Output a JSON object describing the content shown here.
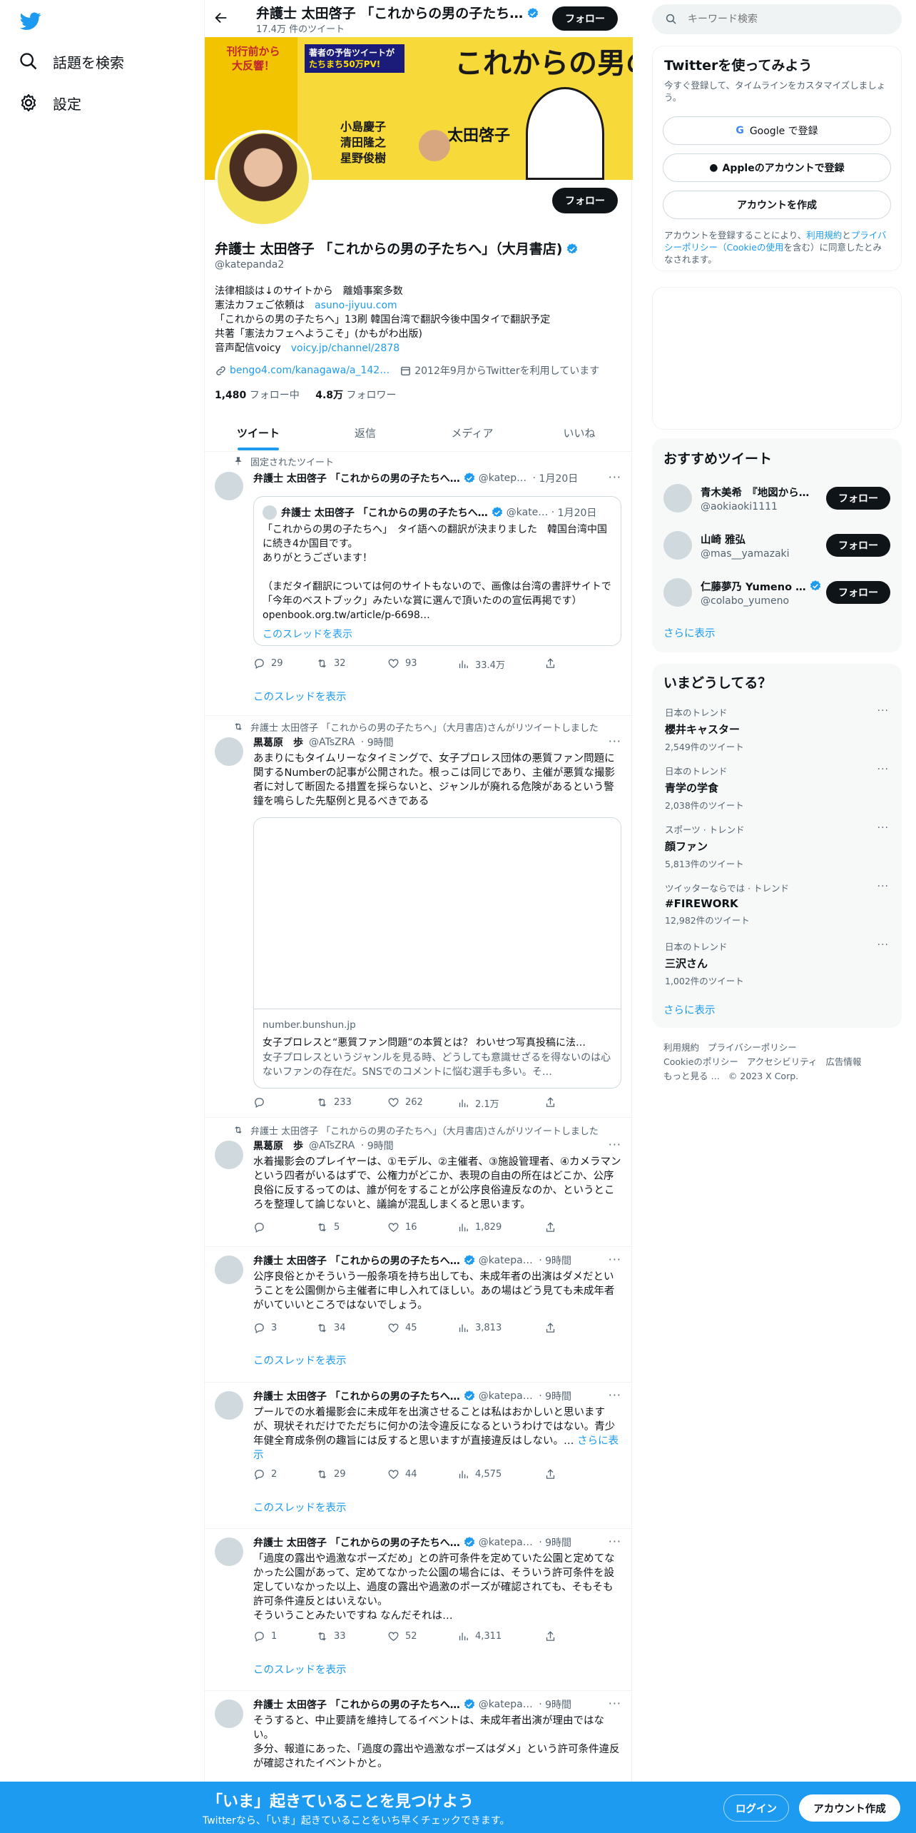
{
  "colors": {
    "accent": "#1d9bf0",
    "text": "#0f1419",
    "muted": "#536471",
    "banner_bg": "#f7d93a"
  },
  "left_nav": {
    "logo": "twitter-bird-icon",
    "items": [
      {
        "label": "話題を検索",
        "icon": "hashtag-search-icon"
      },
      {
        "label": "設定",
        "icon": "gear-icon"
      }
    ]
  },
  "header": {
    "name": "弁護士 太田啓子 「これからの男の子たち…",
    "tweet_count": "17.4万 件のツイート",
    "follow_label": "フォロー"
  },
  "banner": {
    "lines": [
      "これからの",
      "男の子たちへ"
    ],
    "badge": [
      "刊行前から",
      "大反響！"
    ],
    "promo": [
      "著者の予告ツイートが",
      "たちまち50万PV!"
    ],
    "author": "太田啓子",
    "guests": [
      "小島慶子",
      "清田隆之",
      "星野俊樹"
    ]
  },
  "profile": {
    "display_name": "弁護士 太田啓子 「これからの男の子たちへ」（大月書店)",
    "handle": "@katepanda2",
    "follow_label": "フォロー",
    "bio": [
      {
        "text": "法律相談は↓のサイトから　離婚事案多数",
        "link": ""
      },
      {
        "text": "憲法カフェご依頼は　",
        "link": "asuno-jiyuu.com"
      },
      {
        "text": "「これからの男の子たちへ」13刷 韓国台湾で翻訳今後中国タイで翻訳予定",
        "link": ""
      },
      {
        "text": "共著「憲法カフェへようこそ」(かもがわ出版)",
        "link": ""
      },
      {
        "text": "音声配信voicy　",
        "link": "voicy.jp/channel/2878"
      }
    ],
    "website": "bengo4.com/kanagawa/a_142…",
    "joined": "2012年9月からTwitterを利用しています",
    "following_count": "1,480",
    "following_label": "フォロー中",
    "followers_count": "4.8万",
    "followers_label": "フォロワー"
  },
  "tabs": [
    {
      "label": "ツイート",
      "active": true
    },
    {
      "label": "返信",
      "active": false
    },
    {
      "label": "メディア",
      "active": false
    },
    {
      "label": "いいね",
      "active": false
    }
  ],
  "tweets": [
    {
      "pinned_label": "固定されたツイート",
      "name": "弁護士 太田啓子 「これからの男の子たちへ…",
      "handle": "@katep…",
      "time": "1月20日",
      "quote": {
        "name": "弁護士 太田啓子 「これからの男の子たちへ…",
        "handle": "@kate…",
        "time": "1月20日",
        "text": "「これからの男の子たちへ」　タイ語への翻訳が決まりました　韓国台湾中国に続き4か国目です。\nありがとうございます！\n\n（まだタイ翻訳については何のサイトもないので、画像は台湾の書評サイトで「今年のベストブック」みたいな賞に選んで頂いたのの宣伝再掲です） openbook.org.tw/article/p-6698…",
        "thread_link": "このスレッドを表示"
      },
      "stats": {
        "replies": "29",
        "retweets": "32",
        "likes": "93",
        "views": "33.4万"
      },
      "thread_link": "このスレッドを表示"
    },
    {
      "retweet_label": "弁護士 太田啓子 「これからの男の子たちへ」（大月書店)さんがリツイートしました",
      "name": "黒葛原　歩",
      "handle": "@ATsZRA",
      "time": "9時間",
      "text": "あまりにもタイムリーなタイミングで、女子プロレス団体の悪質ファン問題に関するNumberの記事が公開された。根っこは同じであり、主催が悪質な撮影者に対して断固たる措置を採らないと、ジャンルが廃れる危険があるという警鐘を鳴らした先駆例と見るべきである",
      "card": {
        "domain": "number.bunshun.jp",
        "title": "女子プロレスと“悪質ファン問題”の本質とは？ わいせつ写真投稿に法…",
        "desc": "女子プロレスというジャンルを見る時、どうしても意識せざるを得ないのは心ないファンの存在だ。SNSでのコメントに悩む選手も多い。そ…"
      },
      "stats": {
        "replies": "",
        "retweets": "233",
        "likes": "262",
        "views": "2.1万"
      }
    },
    {
      "retweet_label": "弁護士 太田啓子 「これからの男の子たちへ」（大月書店)さんがリツイートしました",
      "name": "黒葛原　歩",
      "handle": "@ATsZRA",
      "time": "9時間",
      "text": "水着撮影会のプレイヤーは、①モデル、②主催者、③施設管理者、④カメラマンという四者がいるはずで、公権力がどこか、表現の自由の所在はどこか、公序良俗に反するってのは、誰が何をすることが公序良俗違反なのか、というところを整理して論じないと、議論が混乱しまくると思います。",
      "stats": {
        "replies": "",
        "retweets": "5",
        "likes": "16",
        "views": "1,829"
      }
    },
    {
      "name": "弁護士 太田啓子 「これからの男の子たちへ…",
      "handle": "@katepa…",
      "time": "9時間",
      "text": "公序良俗とかそういう一般条項を持ち出しても、未成年者の出演はダメだということを公園側から主催者に申し入れてほしい。あの場はどう見ても未成年者がいていいところではないでしょう。",
      "stats": {
        "replies": "3",
        "retweets": "34",
        "likes": "45",
        "views": "3,813"
      },
      "thread_link": "このスレッドを表示"
    },
    {
      "name": "弁護士 太田啓子 「これからの男の子たちへ…",
      "handle": "@katepa…",
      "time": "9時間",
      "text": "プールでの水着撮影会に未成年を出演させることは私はおかしいと思いますが、現状それだけでただちに何かの法令違反になるというわけではない。青少年健全育成条例の趣旨には反すると思いますが直接違反はしない。…",
      "more_link": "さらに表示",
      "stats": {
        "replies": "2",
        "retweets": "29",
        "likes": "44",
        "views": "4,575"
      },
      "thread_link": "このスレッドを表示"
    },
    {
      "name": "弁護士 太田啓子 「これからの男の子たちへ…",
      "handle": "@katepa…",
      "time": "9時間",
      "text": "「過度の露出や過激なポーズだめ」との許可条件を定めていた公園と定めてなかった公園があって、定めてなかった公園の場合には、そういう許可条件を設定していなかった以上、過度の露出や過激のポーズが確認されても、そもそも許可条件違反とはいえない。\nそういうことみたいですね なんだそれは…",
      "stats": {
        "replies": "1",
        "retweets": "33",
        "likes": "52",
        "views": "4,311"
      },
      "thread_link": "このスレッドを表示"
    },
    {
      "name": "弁護士 太田啓子 「これからの男の子たちへ…",
      "handle": "@katepa…",
      "time": "9時間",
      "text": "そうすると、中止要請を維持してるイベントは、未成年者出演が理由ではない。\n多分、報道にあった、「過度の露出や過激なポーズはダメ」という許可条件違反が確認されたイベントかと。"
    }
  ],
  "search": {
    "placeholder": "キーワード検索",
    "icon": "search-icon"
  },
  "signup": {
    "title": "Twitterを使ってみよう",
    "subtitle": "今すぐ登録して、タイムラインをカスタマイズしましょう。",
    "google_label": "Google で登録",
    "apple_label": "Appleのアカウントで登録",
    "create_label": "アカウントを作成",
    "terms_prefix": "アカウントを登録することにより、",
    "terms_link": "利用規約",
    "terms_mid": "と",
    "privacy_link": "プライバシーポリシー",
    "cookie_link": "（Cookieの使用",
    "terms_suffix": "を含む）に同意したとみなされます。"
  },
  "recommended": {
    "title": "おすすめツイート",
    "users": [
      {
        "name": "青木美希　『地図から…",
        "handle": "@aokiaoki1111",
        "verified": false
      },
      {
        "name": "山崎 雅弘",
        "handle": "@mas__yamazaki",
        "verified": false
      },
      {
        "name": "仁藤夢乃 Yumeno …",
        "handle": "@colabo_yumeno",
        "verified": true
      }
    ],
    "follow_label": "フォロー",
    "more_label": "さらに表示"
  },
  "trends": {
    "title": "いまどうしてる？",
    "items": [
      {
        "meta": "日本のトレンド",
        "name": "櫻井キャスター",
        "count": "2,549件のツイート"
      },
      {
        "meta": "日本のトレンド",
        "name": "青学の学食",
        "count": "2,038件のツイート"
      },
      {
        "meta": "スポーツ · トレンド",
        "name": "顔ファン",
        "count": "5,813件のツイート"
      },
      {
        "meta": "ツイッターならでは · トレンド",
        "name": "#FIREWORK",
        "count": "12,982件のツイート"
      },
      {
        "meta": "日本のトレンド",
        "name": "三沢さん",
        "count": "1,002件のツイート"
      }
    ],
    "more_label": "さらに表示"
  },
  "footer_links": [
    "利用規約",
    "プライバシーポリシー",
    "Cookieのポリシー",
    "アクセシビリティ",
    "広告情報",
    "もっと見る …",
    "© 2023 X Corp."
  ],
  "bottom_bar": {
    "title": "「いま」起きていることを見つけよう",
    "subtitle": "Twitterなら、「いま」起きていることをいち早くチェックできます。",
    "login_label": "ログイン",
    "signup_label": "アカウント作成"
  }
}
